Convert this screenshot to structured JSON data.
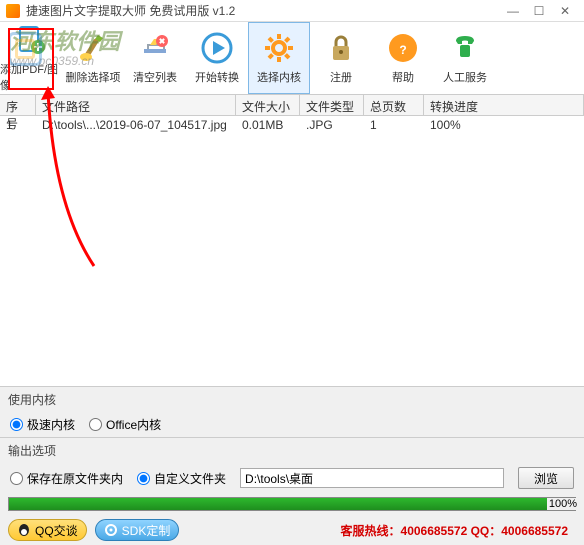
{
  "window": {
    "title": "捷速图片文字提取大师 免费试用版 v1.2"
  },
  "watermark": {
    "cn": "河东软件园",
    "url": "www.pc0359.cn"
  },
  "toolbar": {
    "add": "添加PDF/图像",
    "delete": "删除选择项",
    "clear": "清空列表",
    "start": "开始转换",
    "core": "选择内核",
    "register": "注册",
    "help": "帮助",
    "service": "人工服务"
  },
  "columns": {
    "index": "序号",
    "path": "文件路径",
    "size": "文件大小",
    "type": "文件类型",
    "pages": "总页数",
    "progress": "转换进度"
  },
  "rows": [
    {
      "index": "1",
      "path": "D:\\tools\\...\\2019-06-07_104517.jpg",
      "size": "0.01MB",
      "type": ".JPG",
      "pages": "1",
      "progress": "100%"
    }
  ],
  "core_section": {
    "label": "使用内核",
    "fast": "极速内核",
    "office": "Office内核"
  },
  "output_section": {
    "label": "输出选项",
    "same_folder": "保存在原文件夹内",
    "custom_folder": "自定义文件夹",
    "path_value": "D:\\tools\\桌面",
    "browse": "浏览"
  },
  "progress": {
    "percent": "100%"
  },
  "footer": {
    "qq": "QQ交谈",
    "sdk": "SDK定制",
    "hotline": "客服热线：4006685572 QQ：4006685572"
  }
}
